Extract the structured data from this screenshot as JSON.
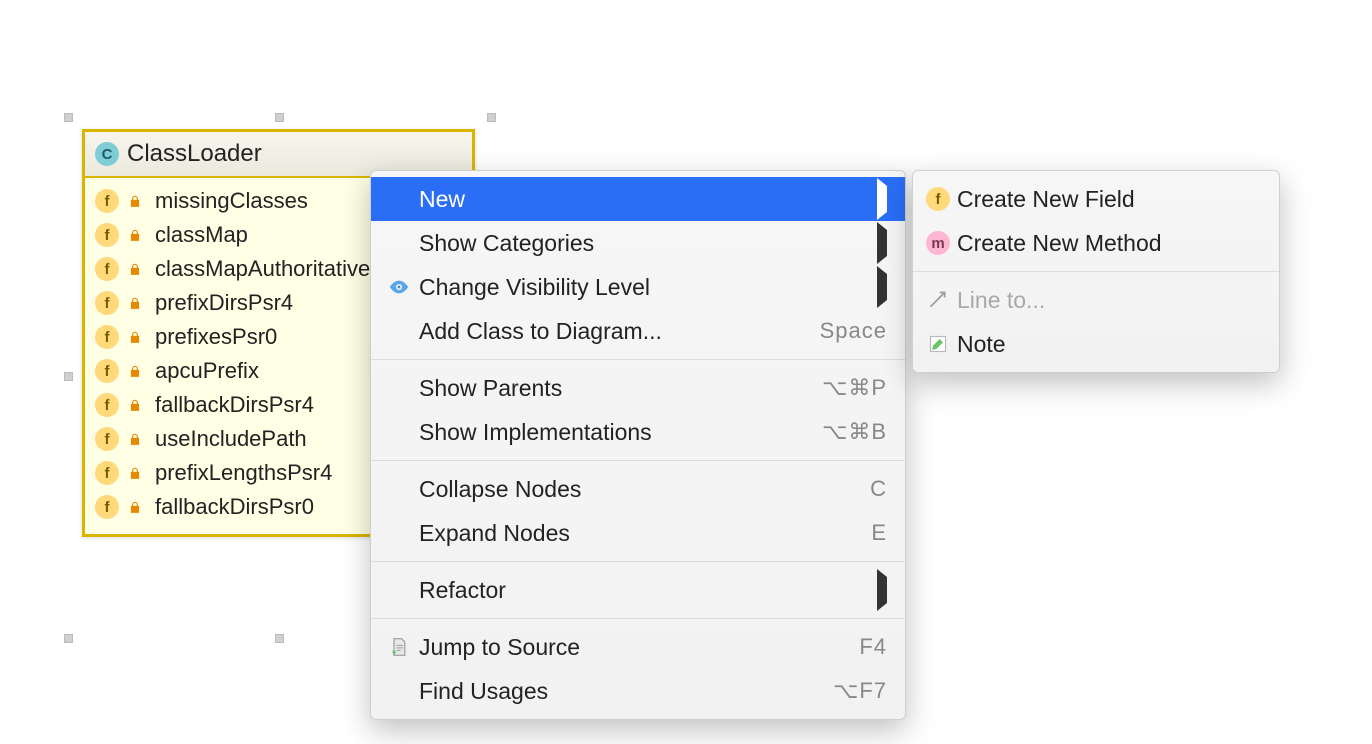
{
  "class_node": {
    "title": "ClassLoader",
    "fields": [
      "missingClasses",
      "classMap",
      "classMapAuthoritative",
      "prefixDirsPsr4",
      "prefixesPsr0",
      "apcuPrefix",
      "fallbackDirsPsr4",
      "useIncludePath",
      "prefixLengthsPsr4",
      "fallbackDirsPsr0"
    ]
  },
  "context_menu": {
    "groups": [
      [
        {
          "label": "New",
          "shortcut": "",
          "arrow": true,
          "highlight": true,
          "icon": ""
        },
        {
          "label": "Show Categories",
          "shortcut": "",
          "arrow": true,
          "highlight": false,
          "icon": ""
        },
        {
          "label": "Change Visibility Level",
          "shortcut": "",
          "arrow": true,
          "highlight": false,
          "icon": "eye"
        },
        {
          "label": "Add Class to Diagram...",
          "shortcut": "Space",
          "arrow": false,
          "highlight": false,
          "icon": ""
        }
      ],
      [
        {
          "label": "Show Parents",
          "shortcut": "⌥⌘P",
          "arrow": false,
          "highlight": false,
          "icon": ""
        },
        {
          "label": "Show Implementations",
          "shortcut": "⌥⌘B",
          "arrow": false,
          "highlight": false,
          "icon": ""
        }
      ],
      [
        {
          "label": "Collapse Nodes",
          "shortcut": "C",
          "arrow": false,
          "highlight": false,
          "icon": ""
        },
        {
          "label": "Expand Nodes",
          "shortcut": "E",
          "arrow": false,
          "highlight": false,
          "icon": ""
        }
      ],
      [
        {
          "label": "Refactor",
          "shortcut": "",
          "arrow": true,
          "highlight": false,
          "icon": ""
        }
      ],
      [
        {
          "label": "Jump to Source",
          "shortcut": "F4",
          "arrow": false,
          "highlight": false,
          "icon": "doc"
        },
        {
          "label": "Find Usages",
          "shortcut": "⌥F7",
          "arrow": false,
          "highlight": false,
          "icon": ""
        }
      ]
    ]
  },
  "submenu": {
    "groups": [
      [
        {
          "label": "Create New Field",
          "icon": "f",
          "disabled": false
        },
        {
          "label": "Create New Method",
          "icon": "m",
          "disabled": false
        }
      ],
      [
        {
          "label": "Line to...",
          "icon": "lineto",
          "disabled": true
        },
        {
          "label": "Note",
          "icon": "note",
          "disabled": false
        }
      ]
    ]
  }
}
